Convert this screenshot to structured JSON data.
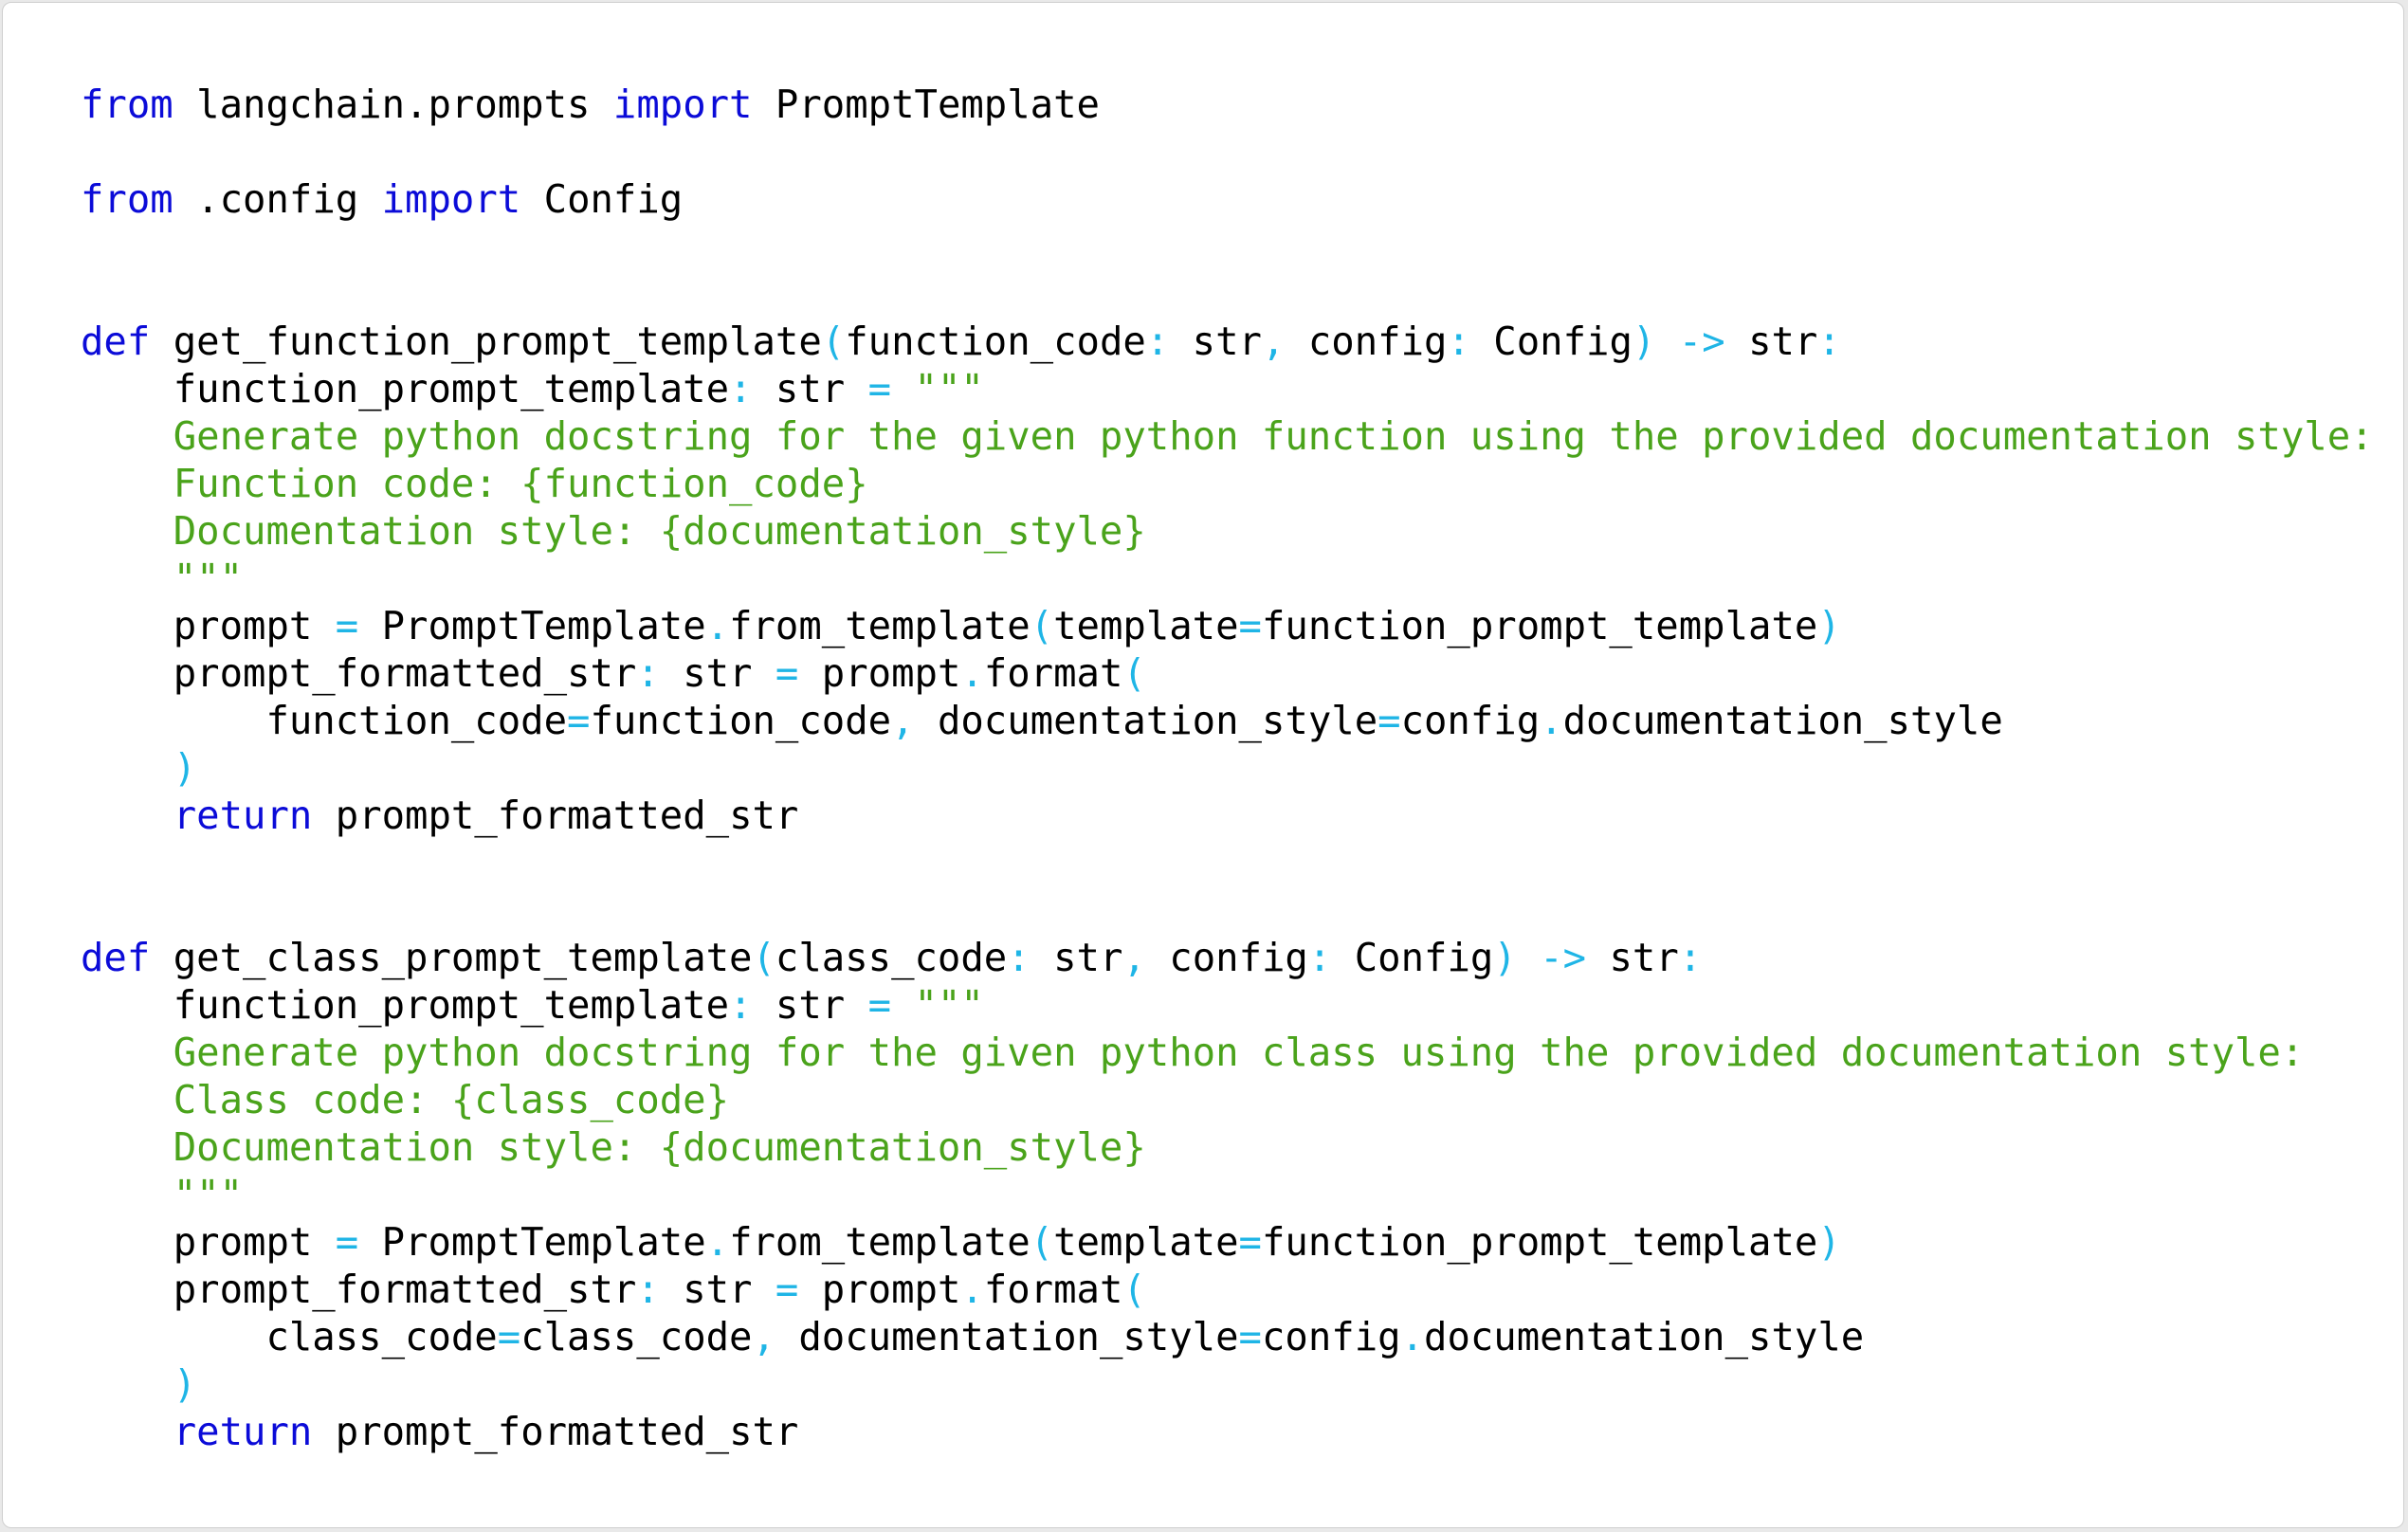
{
  "colors": {
    "keyword": "#0b0bd8",
    "operator": "#1fb5e6",
    "string": "#4aa31b",
    "text": "#000000",
    "background": "#ffffff"
  },
  "code_lines": [
    [
      {
        "t": "kw",
        "v": "from"
      },
      {
        "t": "id",
        "v": " langchain.prompts "
      },
      {
        "t": "kw",
        "v": "import"
      },
      {
        "t": "id",
        "v": " PromptTemplate"
      }
    ],
    [],
    [
      {
        "t": "kw",
        "v": "from"
      },
      {
        "t": "id",
        "v": " .config "
      },
      {
        "t": "kw",
        "v": "import"
      },
      {
        "t": "id",
        "v": " Config"
      }
    ],
    [],
    [],
    [
      {
        "t": "kw",
        "v": "def"
      },
      {
        "t": "id",
        "v": " get_function_prompt_template"
      },
      {
        "t": "op",
        "v": "("
      },
      {
        "t": "id",
        "v": "function_code"
      },
      {
        "t": "op",
        "v": ":"
      },
      {
        "t": "id",
        "v": " str"
      },
      {
        "t": "op",
        "v": ","
      },
      {
        "t": "id",
        "v": " config"
      },
      {
        "t": "op",
        "v": ":"
      },
      {
        "t": "id",
        "v": " Config"
      },
      {
        "t": "op",
        "v": ")"
      },
      {
        "t": "id",
        "v": " "
      },
      {
        "t": "op",
        "v": "->"
      },
      {
        "t": "id",
        "v": " str"
      },
      {
        "t": "op",
        "v": ":"
      }
    ],
    [
      {
        "t": "id",
        "v": "    function_prompt_template"
      },
      {
        "t": "op",
        "v": ":"
      },
      {
        "t": "id",
        "v": " str "
      },
      {
        "t": "op",
        "v": "="
      },
      {
        "t": "id",
        "v": " "
      },
      {
        "t": "str",
        "v": "\"\"\""
      }
    ],
    [
      {
        "t": "str",
        "v": "    Generate python docstring for the given python function using the provided documentation style:"
      }
    ],
    [
      {
        "t": "str",
        "v": "    Function code: {function_code}"
      }
    ],
    [
      {
        "t": "str",
        "v": "    Documentation style: {documentation_style}"
      }
    ],
    [
      {
        "t": "str",
        "v": "    \"\"\""
      }
    ],
    [
      {
        "t": "id",
        "v": "    prompt "
      },
      {
        "t": "op",
        "v": "="
      },
      {
        "t": "id",
        "v": " PromptTemplate"
      },
      {
        "t": "op",
        "v": "."
      },
      {
        "t": "id",
        "v": "from_template"
      },
      {
        "t": "op",
        "v": "("
      },
      {
        "t": "id",
        "v": "template"
      },
      {
        "t": "op",
        "v": "="
      },
      {
        "t": "id",
        "v": "function_prompt_template"
      },
      {
        "t": "op",
        "v": ")"
      }
    ],
    [
      {
        "t": "id",
        "v": "    prompt_formatted_str"
      },
      {
        "t": "op",
        "v": ":"
      },
      {
        "t": "id",
        "v": " str "
      },
      {
        "t": "op",
        "v": "="
      },
      {
        "t": "id",
        "v": " prompt"
      },
      {
        "t": "op",
        "v": "."
      },
      {
        "t": "id",
        "v": "format"
      },
      {
        "t": "op",
        "v": "("
      }
    ],
    [
      {
        "t": "id",
        "v": "        function_code"
      },
      {
        "t": "op",
        "v": "="
      },
      {
        "t": "id",
        "v": "function_code"
      },
      {
        "t": "op",
        "v": ","
      },
      {
        "t": "id",
        "v": " documentation_style"
      },
      {
        "t": "op",
        "v": "="
      },
      {
        "t": "id",
        "v": "config"
      },
      {
        "t": "op",
        "v": "."
      },
      {
        "t": "id",
        "v": "documentation_style"
      }
    ],
    [
      {
        "t": "op",
        "v": "    )"
      }
    ],
    [
      {
        "t": "id",
        "v": "    "
      },
      {
        "t": "kw",
        "v": "return"
      },
      {
        "t": "id",
        "v": " prompt_formatted_str"
      }
    ],
    [],
    [],
    [
      {
        "t": "kw",
        "v": "def"
      },
      {
        "t": "id",
        "v": " get_class_prompt_template"
      },
      {
        "t": "op",
        "v": "("
      },
      {
        "t": "id",
        "v": "class_code"
      },
      {
        "t": "op",
        "v": ":"
      },
      {
        "t": "id",
        "v": " str"
      },
      {
        "t": "op",
        "v": ","
      },
      {
        "t": "id",
        "v": " config"
      },
      {
        "t": "op",
        "v": ":"
      },
      {
        "t": "id",
        "v": " Config"
      },
      {
        "t": "op",
        "v": ")"
      },
      {
        "t": "id",
        "v": " "
      },
      {
        "t": "op",
        "v": "->"
      },
      {
        "t": "id",
        "v": " str"
      },
      {
        "t": "op",
        "v": ":"
      }
    ],
    [
      {
        "t": "id",
        "v": "    function_prompt_template"
      },
      {
        "t": "op",
        "v": ":"
      },
      {
        "t": "id",
        "v": " str "
      },
      {
        "t": "op",
        "v": "="
      },
      {
        "t": "id",
        "v": " "
      },
      {
        "t": "str",
        "v": "\"\"\""
      }
    ],
    [
      {
        "t": "str",
        "v": "    Generate python docstring for the given python class using the provided documentation style:"
      }
    ],
    [
      {
        "t": "str",
        "v": "    Class code: {class_code}"
      }
    ],
    [
      {
        "t": "str",
        "v": "    Documentation style: {documentation_style}"
      }
    ],
    [
      {
        "t": "str",
        "v": "    \"\"\""
      }
    ],
    [
      {
        "t": "id",
        "v": "    prompt "
      },
      {
        "t": "op",
        "v": "="
      },
      {
        "t": "id",
        "v": " PromptTemplate"
      },
      {
        "t": "op",
        "v": "."
      },
      {
        "t": "id",
        "v": "from_template"
      },
      {
        "t": "op",
        "v": "("
      },
      {
        "t": "id",
        "v": "template"
      },
      {
        "t": "op",
        "v": "="
      },
      {
        "t": "id",
        "v": "function_prompt_template"
      },
      {
        "t": "op",
        "v": ")"
      }
    ],
    [
      {
        "t": "id",
        "v": "    prompt_formatted_str"
      },
      {
        "t": "op",
        "v": ":"
      },
      {
        "t": "id",
        "v": " str "
      },
      {
        "t": "op",
        "v": "="
      },
      {
        "t": "id",
        "v": " prompt"
      },
      {
        "t": "op",
        "v": "."
      },
      {
        "t": "id",
        "v": "format"
      },
      {
        "t": "op",
        "v": "("
      }
    ],
    [
      {
        "t": "id",
        "v": "        class_code"
      },
      {
        "t": "op",
        "v": "="
      },
      {
        "t": "id",
        "v": "class_code"
      },
      {
        "t": "op",
        "v": ","
      },
      {
        "t": "id",
        "v": " documentation_style"
      },
      {
        "t": "op",
        "v": "="
      },
      {
        "t": "id",
        "v": "config"
      },
      {
        "t": "op",
        "v": "."
      },
      {
        "t": "id",
        "v": "documentation_style"
      }
    ],
    [
      {
        "t": "op",
        "v": "    )"
      }
    ],
    [
      {
        "t": "id",
        "v": "    "
      },
      {
        "t": "kw",
        "v": "return"
      },
      {
        "t": "id",
        "v": " prompt_formatted_str"
      }
    ]
  ]
}
